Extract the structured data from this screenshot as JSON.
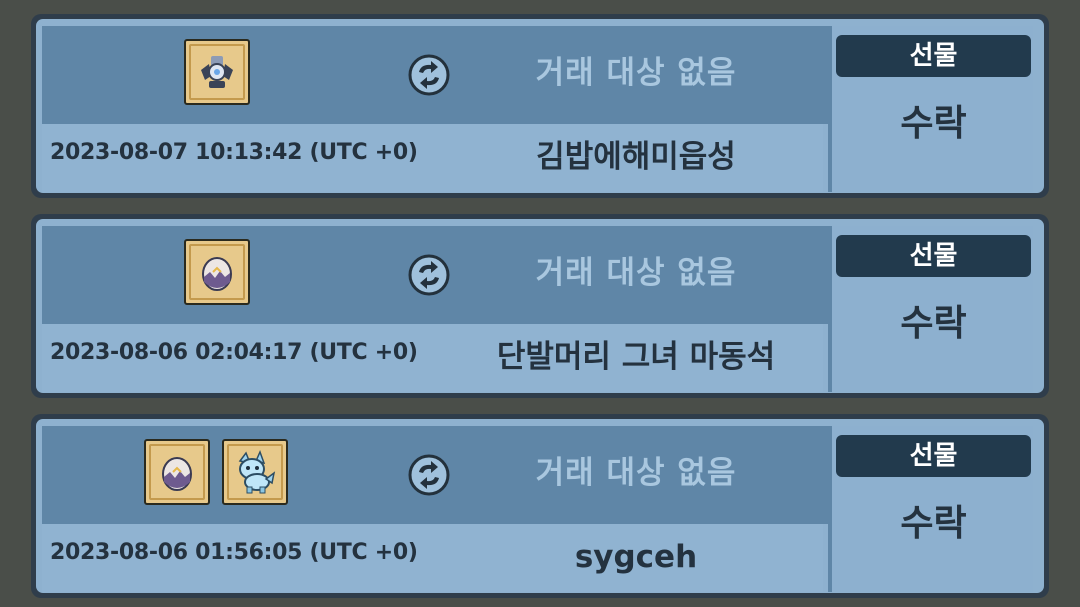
{
  "trades": [
    {
      "status": "거래 대상 없음",
      "timestamp": "2023-08-07 10:13:42 (UTC +0)",
      "name": "김밥에해미읍성",
      "tag": "선물",
      "action": "수락",
      "items": [
        "winged-crest-icon"
      ]
    },
    {
      "status": "거래 대상 없음",
      "timestamp": "2023-08-06 02:04:17 (UTC +0)",
      "name": "단발머리 그녀 마동석",
      "tag": "선물",
      "action": "수락",
      "items": [
        "egg-icon"
      ]
    },
    {
      "status": "거래 대상 없음",
      "timestamp": "2023-08-06 01:56:05 (UTC +0)",
      "name": "sygceh",
      "tag": "선물",
      "action": "수락",
      "items": [
        "egg-icon",
        "blue-dragon-pet-icon"
      ]
    }
  ],
  "colors": {
    "accent_dark": "#223a4d",
    "panel_mid": "#5f86a7",
    "panel_light": "#8eb1cf",
    "item_slot": "#e7c98b"
  }
}
